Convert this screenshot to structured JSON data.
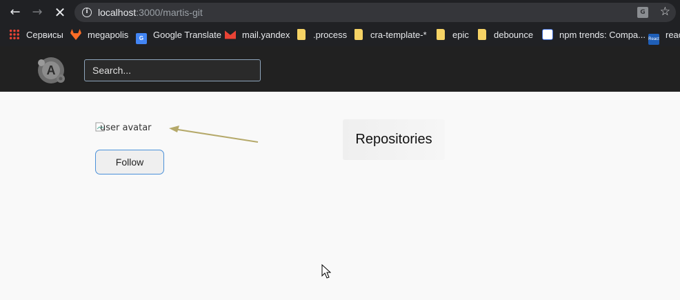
{
  "browser": {
    "back_icon": "arrow-left-icon",
    "forward_icon": "arrow-right-icon",
    "stop_icon": "close-icon",
    "url_host": "localhost",
    "url_path": ":3000/martis-git",
    "translate_icon": "translate-icon",
    "bookmark_icon": "star-icon"
  },
  "bookmarks": [
    {
      "label": "Сервисы",
      "icon": "apps-grid-icon"
    },
    {
      "label": "megapolis",
      "icon": "gitlab-icon"
    },
    {
      "label": "Google Translate",
      "icon": "google-translate-icon"
    },
    {
      "label": "mail.yandex",
      "icon": "mail-icon"
    },
    {
      "label": ".process",
      "icon": "folder-icon"
    },
    {
      "label": "cra-template-*",
      "icon": "folder-icon"
    },
    {
      "label": "epic",
      "icon": "folder-icon"
    },
    {
      "label": "debounce",
      "icon": "folder-icon"
    },
    {
      "label": "npm trends: Compa...",
      "icon": "npm-trends-icon"
    },
    {
      "label": "reac",
      "icon": "react-icon"
    }
  ],
  "header": {
    "logo_icon": "app-logo-icon",
    "logo_letter": "A",
    "search_placeholder": "Search..."
  },
  "main": {
    "avatar_alt": "user avatar",
    "follow_label": "Follow",
    "repositories_label": "Repositories"
  },
  "colors": {
    "chrome_bg": "#202124",
    "header_bg": "#212121",
    "page_bg": "#f9f9f9",
    "annotation_arrow": "#b5a96a",
    "follow_border": "#4a90d9"
  }
}
